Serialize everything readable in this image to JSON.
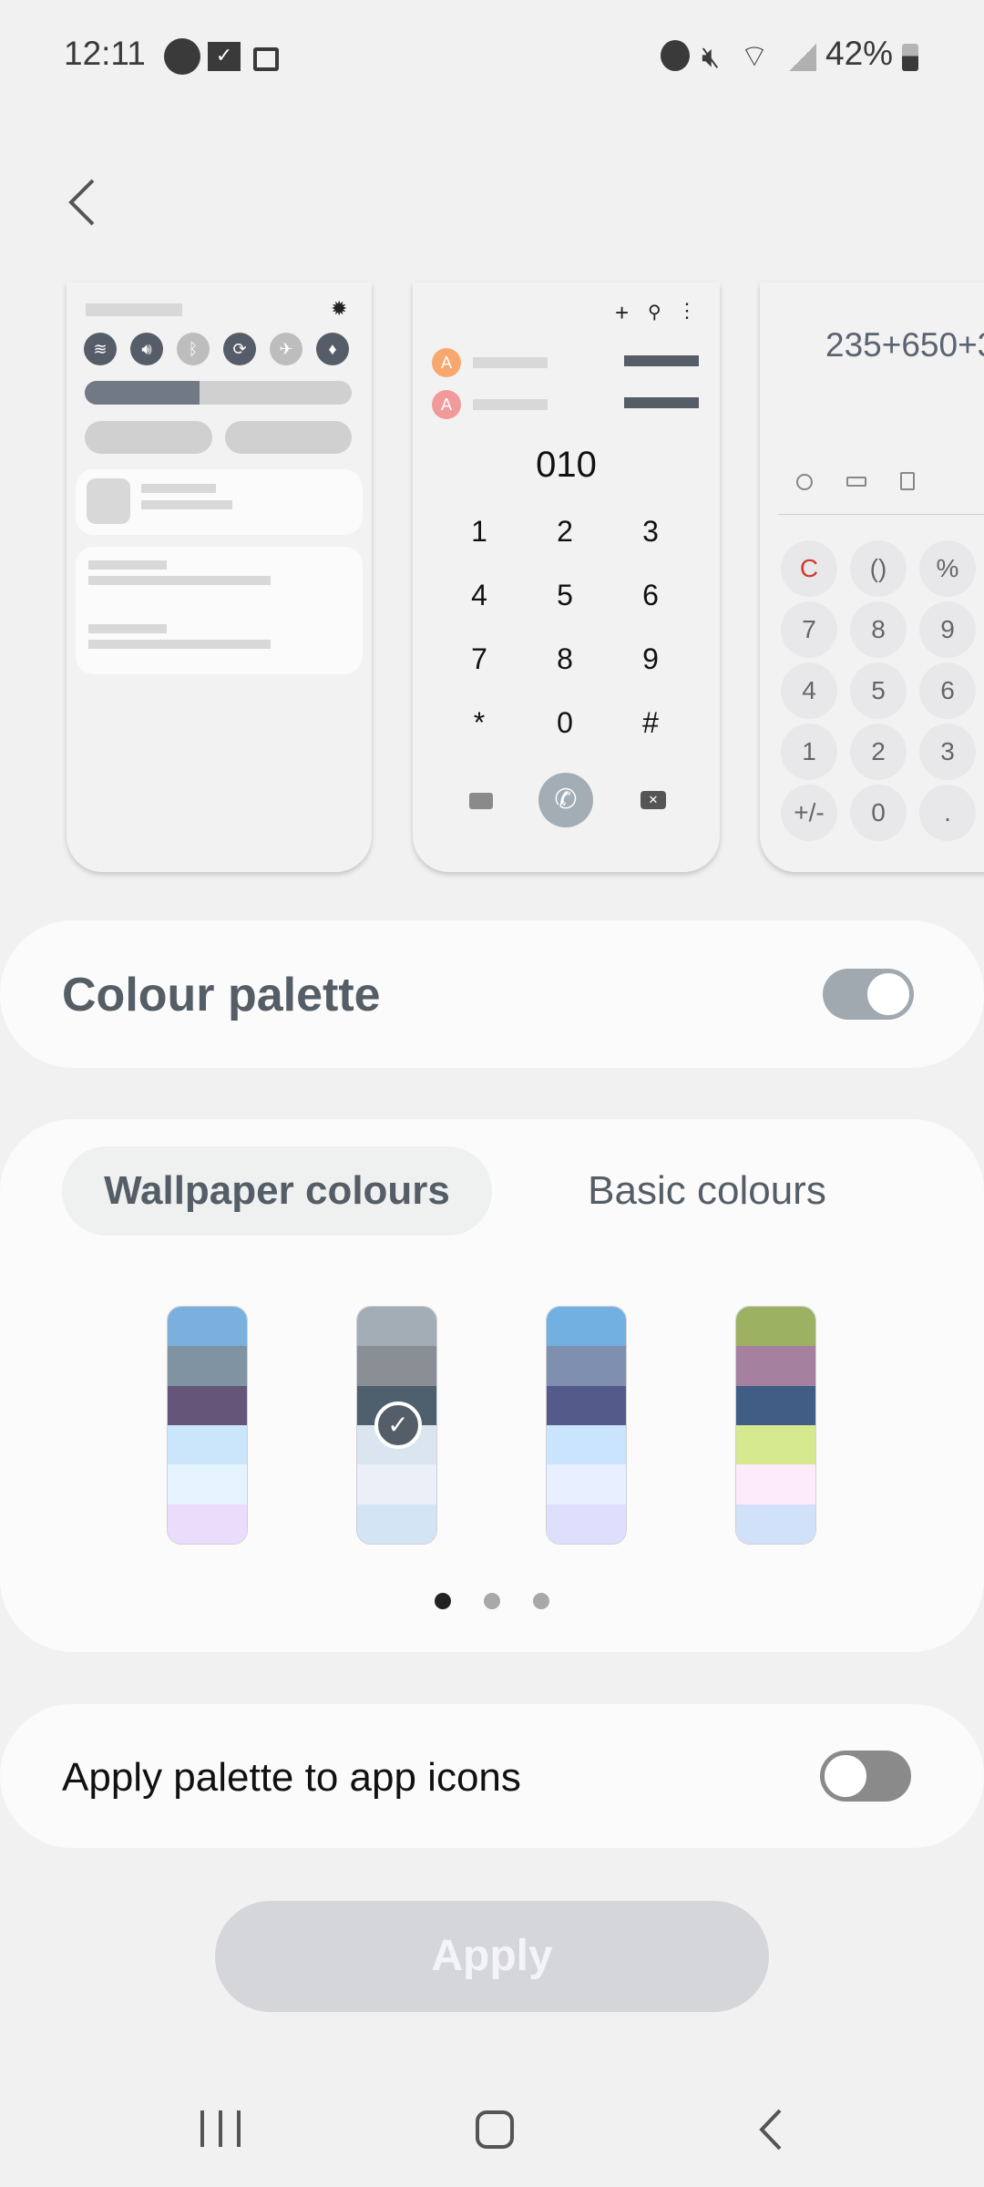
{
  "status_bar": {
    "time": "12:11",
    "battery": "42%",
    "left_icons": [
      "flashlight-icon",
      "email-icon",
      "lock-icon"
    ],
    "right_icons": [
      "alarm-icon",
      "mute-icon",
      "wifi-icon",
      "signal-icon",
      "battery-icon"
    ]
  },
  "previews": {
    "quick_panel": {
      "icons": [
        "wifi",
        "sound",
        "bluetooth",
        "auto-rotate",
        "airplane",
        "flashlight"
      ],
      "brightness": 0.43
    },
    "dialer": {
      "contact_initial": "A",
      "number": "010",
      "keys": [
        "1",
        "2",
        "3",
        "4",
        "5",
        "6",
        "7",
        "8",
        "9",
        "*",
        "0",
        "#"
      ]
    },
    "calculator": {
      "expression": "235+650+3",
      "keys": [
        "C",
        "()",
        "%",
        "7",
        "8",
        "9",
        "4",
        "5",
        "6",
        "1",
        "2",
        "3",
        "+/-",
        "0",
        "."
      ]
    }
  },
  "colour_palette": {
    "label": "Colour palette",
    "enabled": true,
    "accent": "#a0a8b0"
  },
  "palette_tabs": [
    {
      "label": "Wallpaper colours",
      "selected": true
    },
    {
      "label": "Basic colours",
      "selected": false
    }
  ],
  "swatches": [
    {
      "colors": [
        "#7bb0de",
        "#7f93a2",
        "#655679",
        "#cbe5fb",
        "#e5f3fe",
        "#ecdcfb"
      ],
      "selected": false
    },
    {
      "colors": [
        "#a2adb6",
        "#8a8f96",
        "#4e5f6d",
        "#dbe5f0",
        "#ebeff8",
        "#d3e4f4"
      ],
      "selected": true
    },
    {
      "colors": [
        "#72b0e2",
        "#7f8fb0",
        "#545b8b",
        "#c9e4fc",
        "#e8effe",
        "#dedffd"
      ],
      "selected": false
    },
    {
      "colors": [
        "#9db162",
        "#a6819f",
        "#405d86",
        "#d6e98f",
        "#fdeafa",
        "#d1e1fa"
      ],
      "selected": false
    }
  ],
  "page_indicator": {
    "current": 1,
    "total": 3
  },
  "apply_icons": {
    "label": "Apply palette to app icons",
    "enabled": false
  },
  "apply_button": {
    "label": "Apply",
    "enabled": false
  },
  "nav": {
    "recents": "recents-icon",
    "home": "home-icon",
    "back": "back-icon"
  }
}
